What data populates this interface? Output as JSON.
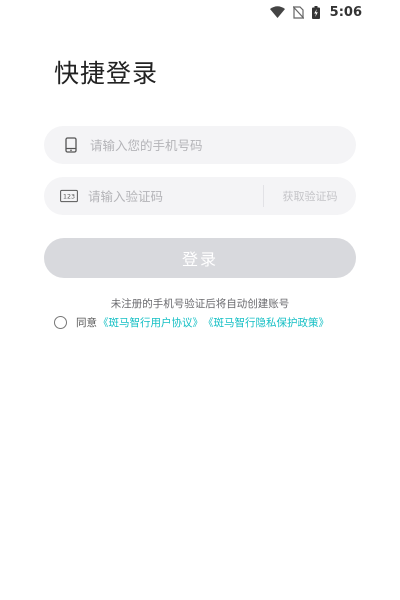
{
  "status_bar": {
    "time": "5:06",
    "icons": [
      "wifi-icon",
      "no-sim-icon",
      "battery-charging-icon"
    ]
  },
  "page": {
    "title": "快捷登录"
  },
  "phone_field": {
    "icon": "phone-icon",
    "placeholder": "请输入您的手机号码",
    "value": ""
  },
  "code_field": {
    "icon": "numeric-123-icon",
    "placeholder": "请输入验证码",
    "value": "",
    "get_code_label": "获取验证码"
  },
  "login_button": {
    "label": "登录"
  },
  "notice": {
    "text": "未注册的手机号验证后将自动创建账号"
  },
  "agreement": {
    "checked": false,
    "prefix": "同意",
    "user_agreement": "《斑马智行用户协议》",
    "privacy_policy": "《斑马智行隐私保护政策》"
  },
  "colors": {
    "link": "#13bfc4",
    "button_disabled": "#d8d9dd",
    "field_bg": "#f4f4f6"
  }
}
